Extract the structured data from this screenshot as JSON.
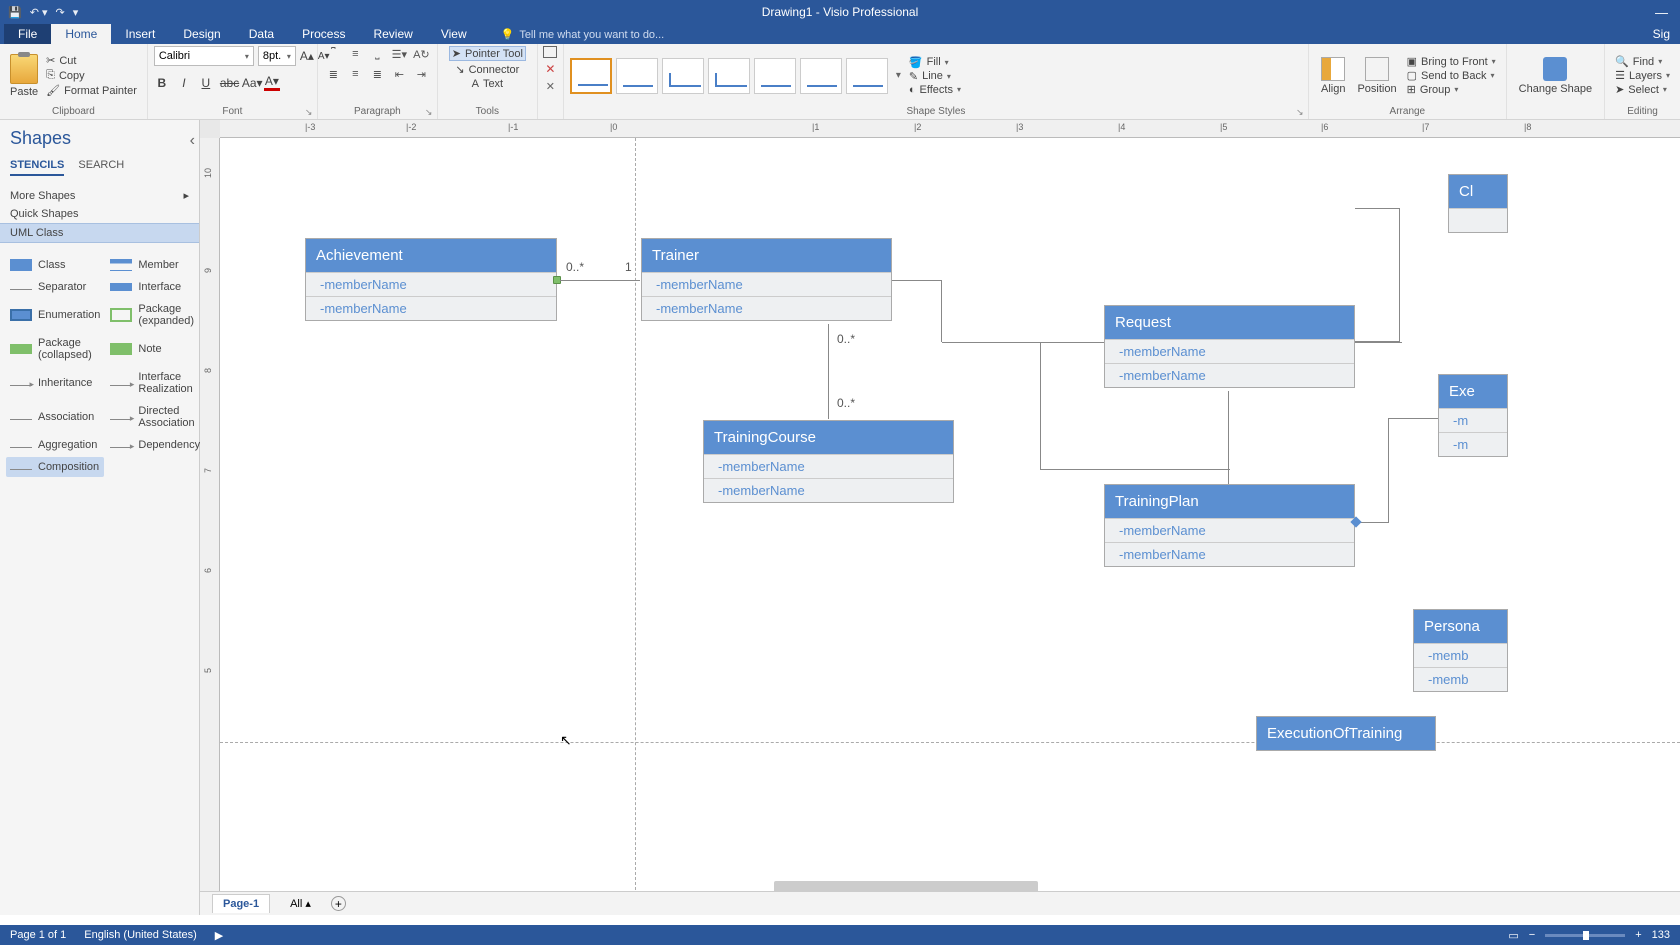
{
  "app": {
    "title": "Drawing1 - Visio Professional"
  },
  "tabs": {
    "file": "File",
    "home": "Home",
    "insert": "Insert",
    "design": "Design",
    "data": "Data",
    "process": "Process",
    "review": "Review",
    "view": "View",
    "tellme": "Tell me what you want to do...",
    "signin": "Sig"
  },
  "ribbon": {
    "clipboard": {
      "label": "Clipboard",
      "paste": "Paste",
      "cut": "Cut",
      "copy": "Copy",
      "formatPainter": "Format Painter"
    },
    "font": {
      "label": "Font",
      "name": "Calibri",
      "size": "8pt."
    },
    "paragraph": {
      "label": "Paragraph"
    },
    "tools": {
      "label": "Tools",
      "pointer": "Pointer Tool",
      "connector": "Connector",
      "text": "Text"
    },
    "shapeStyles": {
      "label": "Shape Styles",
      "fill": "Fill",
      "line": "Line",
      "effects": "Effects"
    },
    "arrange": {
      "label": "Arrange",
      "align": "Align",
      "position": "Position",
      "bringFront": "Bring to Front",
      "sendBack": "Send to Back",
      "group": "Group"
    },
    "changeShape": "Change Shape",
    "editing": {
      "label": "Editing",
      "find": "Find",
      "layers": "Layers",
      "select": "Select"
    }
  },
  "shapesPanel": {
    "title": "Shapes",
    "tabStencils": "STENCILS",
    "tabSearch": "SEARCH",
    "moreShapes": "More Shapes",
    "quickShapes": "Quick Shapes",
    "umlClass": "UML Class",
    "shapes": [
      "Class",
      "Member",
      "Separator",
      "Interface",
      "Enumeration",
      "Package (expanded)",
      "Package (collapsed)",
      "Note",
      "Inheritance",
      "Interface Realization",
      "Association",
      "Directed Association",
      "Aggregation",
      "Dependency",
      "Composition"
    ]
  },
  "canvas": {
    "classes": {
      "achievement": {
        "title": "Achievement",
        "m1": "-memberName",
        "m2": "-memberName"
      },
      "trainer": {
        "title": "Trainer",
        "m1": "-memberName",
        "m2": "-memberName"
      },
      "trainingCourse": {
        "title": "TrainingCourse",
        "m1": "-memberName",
        "m2": "-memberName"
      },
      "request": {
        "title": "Request",
        "m1": "-memberName",
        "m2": "-memberName"
      },
      "trainingPlan": {
        "title": "TrainingPlan",
        "m1": "-memberName",
        "m2": "-memberName"
      },
      "client": {
        "title": "Cl"
      },
      "exercise": {
        "title": "Exe",
        "m1": "-m",
        "m2": "-m"
      },
      "personal": {
        "title": "Persona",
        "m1": "-memb",
        "m2": "-memb"
      },
      "execution": {
        "title": "ExecutionOfTraining"
      }
    },
    "labels": {
      "zeroStar1": "0..*",
      "one": "1",
      "zeroStar2": "0..*",
      "zeroStar3": "0..*"
    }
  },
  "pageTabs": {
    "page1": "Page-1",
    "all": "All"
  },
  "statusbar": {
    "pageInfo": "Page 1 of 1",
    "language": "English (United States)",
    "zoom": "133"
  }
}
